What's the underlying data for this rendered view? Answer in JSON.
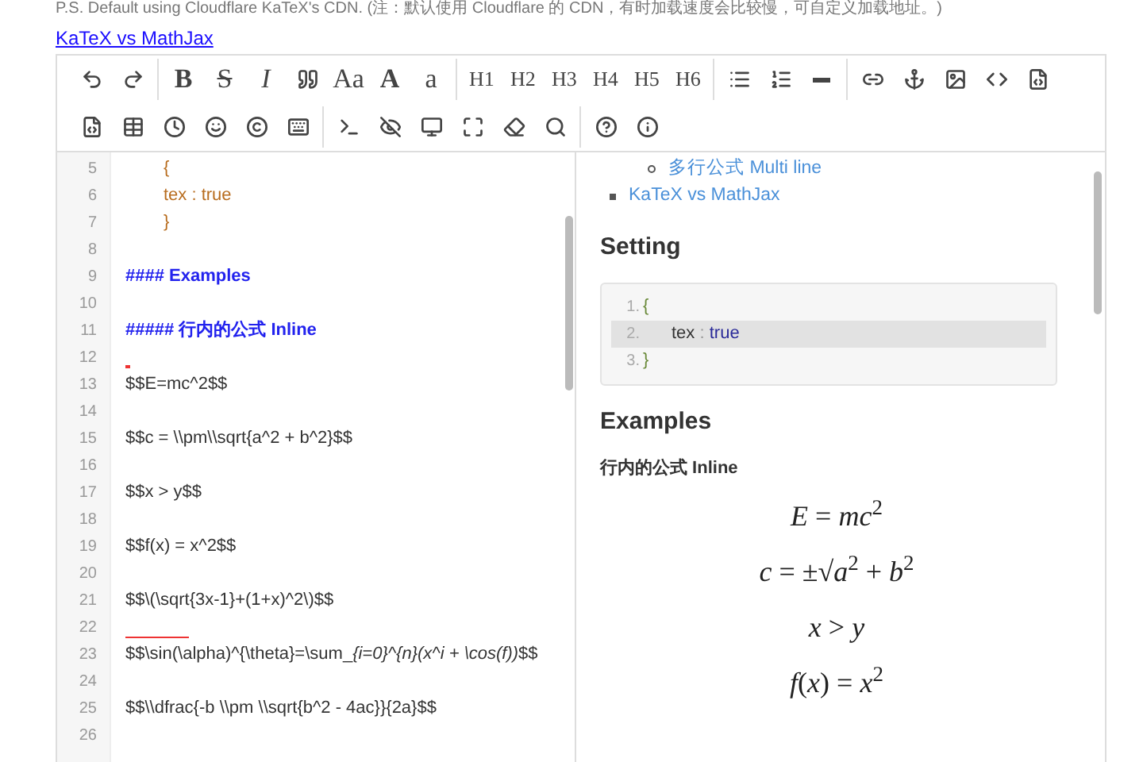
{
  "note": "P.S. Default using Cloudflare KaTeX's CDN. (注：默认使用 Cloudflare 的 CDN，有时加载速度会比较慢，可自定义加载地址。)",
  "link": "KaTeX vs MathJax",
  "toolbar": [
    [
      [
        {
          "kind": "undo"
        },
        {
          "kind": "redo"
        }
      ],
      [
        {
          "kind": "bold",
          "label": "B"
        },
        {
          "kind": "strike",
          "label": "S"
        },
        {
          "kind": "italic",
          "label": "I"
        },
        {
          "kind": "quote"
        },
        {
          "kind": "serif",
          "label": "Aa"
        },
        {
          "kind": "serif-bold",
          "label": "A"
        },
        {
          "kind": "serif",
          "label": "a"
        }
      ],
      [
        {
          "kind": "heading",
          "label": "H1"
        },
        {
          "kind": "heading",
          "label": "H2"
        },
        {
          "kind": "heading",
          "label": "H3"
        },
        {
          "kind": "heading",
          "label": "H4"
        },
        {
          "kind": "heading",
          "label": "H5"
        },
        {
          "kind": "heading",
          "label": "H6"
        }
      ],
      [
        {
          "kind": "list"
        },
        {
          "kind": "ordered-list"
        },
        {
          "kind": "rule"
        }
      ],
      [
        {
          "kind": "link"
        },
        {
          "kind": "anchor"
        },
        {
          "kind": "image"
        },
        {
          "kind": "code"
        },
        {
          "kind": "file-code"
        }
      ]
    ],
    [
      [
        {
          "kind": "file-code"
        },
        {
          "kind": "table"
        },
        {
          "kind": "clock"
        },
        {
          "kind": "smile"
        },
        {
          "kind": "copyright"
        },
        {
          "kind": "keyboard"
        }
      ],
      [
        {
          "kind": "terminal"
        },
        {
          "kind": "eye-off"
        },
        {
          "kind": "monitor"
        },
        {
          "kind": "fullscreen"
        },
        {
          "kind": "eraser"
        },
        {
          "kind": "search"
        }
      ],
      [
        {
          "kind": "help"
        },
        {
          "kind": "info"
        }
      ]
    ]
  ],
  "editor_lines": [
    {
      "number": "5",
      "kind": "brace",
      "text": "{"
    },
    {
      "number": "6",
      "kind": "key",
      "text": "tex  : true"
    },
    {
      "number": "7",
      "kind": "brace",
      "text": "}"
    },
    {
      "number": "8",
      "kind": "blank"
    },
    {
      "number": "9",
      "kind": "heading",
      "text": "#### Examples"
    },
    {
      "number": "10",
      "kind": "blank"
    },
    {
      "number": "11",
      "kind": "heading",
      "text": "##### 行内的公式 Inline"
    },
    {
      "number": "12",
      "kind": "dot-mark"
    },
    {
      "number": "13",
      "kind": "math",
      "text": "$$E=mc^2$$"
    },
    {
      "number": "14",
      "kind": "blank"
    },
    {
      "number": "15",
      "kind": "math",
      "text": "$$c = \\\\pm\\\\sqrt{a^2 + b^2}$$"
    },
    {
      "number": "16",
      "kind": "blank"
    },
    {
      "number": "17",
      "kind": "math",
      "text": "$$x > y$$"
    },
    {
      "number": "18",
      "kind": "blank"
    },
    {
      "number": "19",
      "kind": "math",
      "text": "$$f(x) = x^2$$"
    },
    {
      "number": "20",
      "kind": "blank"
    },
    {
      "number": "21",
      "kind": "math",
      "text": "$$\\(\\sqrt{3x-1}+(1+x)^2\\)$$"
    },
    {
      "number": "22",
      "kind": "line-mark"
    },
    {
      "number": "23",
      "kind": "math",
      "text": "$$\\sin(\\alpha)^{\\theta}=\\sum_",
      "italic": "{i=0}^{n}(x^i + \\cos(f))",
      "suffix": "$$"
    },
    {
      "number": "24",
      "kind": "blank"
    },
    {
      "number": "25",
      "kind": "math",
      "text": "$$\\\\dfrac{-b \\\\pm \\\\sqrt{b^2 - 4ac}}{2a}$$"
    },
    {
      "number": "26",
      "kind": "blank"
    }
  ],
  "preview": {
    "toc": [
      {
        "children": [
          {
            "text": "多行公式 Multi line"
          }
        ]
      },
      {
        "text": "KaTeX vs MathJax"
      }
    ],
    "setting_heading": "Setting",
    "code_lines": [
      {
        "number": "1.",
        "kind": "brace",
        "text": "{",
        "highlighted": false
      },
      {
        "number": "2.",
        "kind": "pair",
        "key": "tex",
        "sep": " : ",
        "value": "true",
        "highlighted": true
      },
      {
        "number": "3.",
        "kind": "brace",
        "text": "}",
        "highlighted": false
      }
    ],
    "examples_heading": "Examples",
    "inline_heading": "行内的公式 Inline",
    "formulas": [
      "*E* = *mc*$^{2}$",
      "*c* = ±√*a*$^{2}$ + *b*$^{2}$",
      "*x* > *y*",
      "*f*(*x*) = *x*$^{2}$"
    ]
  }
}
